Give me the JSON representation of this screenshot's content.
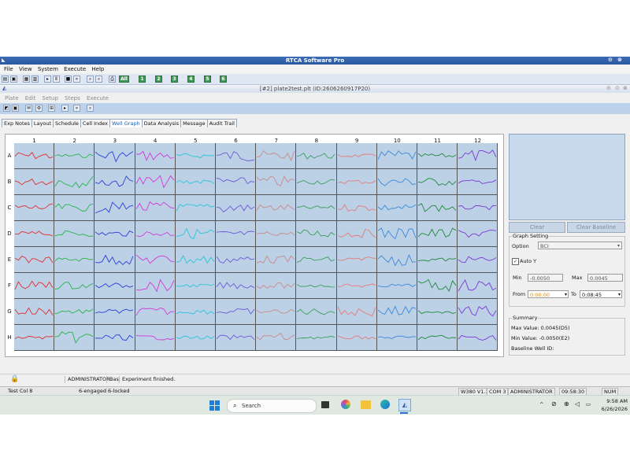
{
  "window": {
    "title": "RTCA Software Pro"
  },
  "menu": [
    "File",
    "View",
    "System",
    "Execute",
    "Help"
  ],
  "toolbar_groups": [
    "All",
    "1",
    "2",
    "3",
    "4",
    "5",
    "6"
  ],
  "document": {
    "title": "[#2] plate2test.plt (ID:2606260917P20)"
  },
  "submenu": [
    "Plate",
    "Edit",
    "Setup",
    "Steps",
    "Execute"
  ],
  "tabs": [
    "Exp Notes",
    "Layout",
    "Schedule",
    "Cell Index",
    "Well Graph",
    "Data Analysis",
    "Message",
    "Audit Trail"
  ],
  "active_tab": "Well Graph",
  "plate": {
    "columns": [
      "1",
      "2",
      "3",
      "4",
      "5",
      "6",
      "7",
      "8",
      "9",
      "10",
      "11",
      "12"
    ],
    "rows": [
      "A",
      "B",
      "C",
      "D",
      "E",
      "F",
      "G",
      "H"
    ],
    "column_colors": [
      "#e03030",
      "#27b44a",
      "#2c3fd8",
      "#d23ad6",
      "#29c5d8",
      "#6a5bd6",
      "#c98a8a",
      "#3aa05a",
      "#e57a7a",
      "#3a8ad8",
      "#1f8a3a",
      "#7a3ad6"
    ]
  },
  "right_panel": {
    "clear_label": "Clear",
    "clear_baseline_label": "Clear Baseline",
    "graph_setting": {
      "legend": "Graph Setting",
      "option_label": "Option",
      "option_value": "BCI",
      "auto_y_label": "Auto Y",
      "min_label": "Min",
      "min_value": "-0.0050",
      "max_label": "Max",
      "max_value": "0.0045",
      "from_label": "From",
      "from_value": "0:00:00",
      "to_label": "To",
      "to_value": "0:08:45"
    },
    "summary": {
      "legend": "Summary",
      "max_value": "Max Value: 0.0045(D5)",
      "min_value": "Min Value: -0.0050(E2)",
      "baseline": "Baseline Well ID:"
    }
  },
  "status_row1": {
    "user": "ADMINISTRATOR",
    "mode": "Bas",
    "message": "Experiment finished."
  },
  "status_row2": {
    "left": "Test Col 8",
    "engaged": "6-engaged  6-locked",
    "version": "W380 V1.3",
    "port": "COM 3",
    "user": "ADMINISTRATOR",
    "time": "09:58:30",
    "num": "NUM"
  },
  "taskbar": {
    "search_placeholder": "Search",
    "clock_time": "9:58 AM",
    "clock_date": "6/26/2026"
  }
}
